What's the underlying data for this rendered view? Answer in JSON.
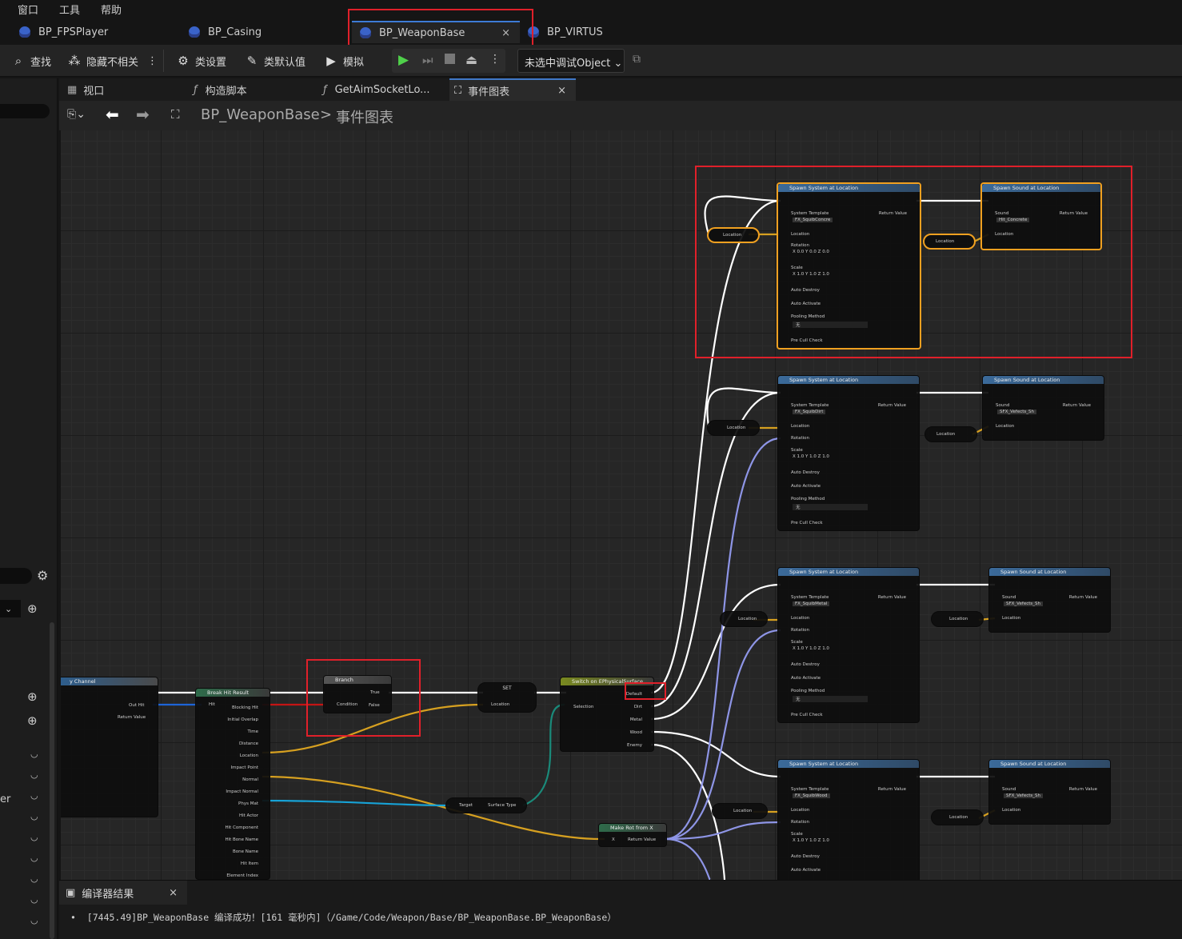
{
  "menu": [
    "窗口",
    "工具",
    "帮助"
  ],
  "file_tabs": [
    {
      "label": "BP_FPSPlayer"
    },
    {
      "label": "BP_Casing"
    },
    {
      "label": "BP_WeaponBase",
      "close": "×"
    },
    {
      "label": "BP_VIRTUS"
    }
  ],
  "toolbar": {
    "find": "查找",
    "hide_unrelated": "隐藏不相关",
    "class_settings": "类设置",
    "class_defaults": "类默认值",
    "simulate": "模拟",
    "debug_object": "未选中调试Object"
  },
  "sub_tabs": [
    {
      "label": "视口"
    },
    {
      "label": "构造脚本"
    },
    {
      "label": "GetAimSocketLo..."
    },
    {
      "label": "事件图表",
      "close": "×"
    }
  ],
  "breadcrumb": {
    "root": "BP_WeaponBase",
    "sep": ">",
    "leaf": "事件图表"
  },
  "left_panel": {
    "text": "er"
  },
  "nodes": {
    "trace": {
      "title": "y Channel",
      "pins": [
        "Out Hit",
        "Return Value"
      ]
    },
    "break_hit": {
      "title": "Break Hit Result",
      "in": "Hit",
      "pins": [
        "Blocking Hit",
        "Initial Overlap",
        "Time",
        "Distance",
        "Location",
        "Impact Point",
        "Normal",
        "Impact Normal",
        "Phys Mat",
        "Hit Actor",
        "Hit Component",
        "Hit Bone Name",
        "Bone Name",
        "Hit Item",
        "Element Index"
      ]
    },
    "branch": {
      "title": "Branch",
      "condition": "Condition",
      "true": "True",
      "false": "False"
    },
    "set": {
      "title": "SET",
      "location": "Location"
    },
    "switch": {
      "title": "Switch on EPhysicalSurface",
      "selection": "Selection",
      "outs": [
        "Default",
        "Dirt",
        "Metal",
        "Wood",
        "Enemy"
      ]
    },
    "surface": {
      "target": "Target",
      "out": "Surface Type"
    },
    "make_rot": {
      "title": "Make Rot from X",
      "x": "X",
      "ret": "Return Value"
    }
  },
  "spawn_system_title": "Spawn System at Location",
  "spawn_sound_title": "Spawn Sound at Location",
  "pin_labels": {
    "system_template": "System Template",
    "return_value": "Return Value",
    "location": "Location",
    "rotation": "Rotation",
    "scale": "Scale",
    "auto_destroy": "Auto Destroy",
    "auto_activate": "Auto Activate",
    "pooling_method": "Pooling Method",
    "pooling_value": "无",
    "pre_cull": "Pre Cull Check",
    "sound": "Sound",
    "zero": "0.0",
    "one": "1.0",
    "x": "X",
    "y": "Y",
    "z": "Z"
  },
  "system_assets": [
    "FX_SquibConcre",
    "FX_SquibDirt",
    "FX_SquibMetal",
    "FX_SquibWood"
  ],
  "sound_assets": [
    "Hit_Concrete",
    "SFX_Vefects_Sh",
    "SFX_Vefects_Sh",
    "SFX_Vefects_Sh"
  ],
  "colors": {
    "exec": "#ffffff",
    "vector": "#f1c232",
    "struct": "#1e64d8",
    "object": "#17a2d6",
    "rotator": "#8e95e6",
    "highlight": "#e0202a"
  },
  "compiler": {
    "tab": "编译器结果",
    "close": "×",
    "message": "[7445.49]BP_WeaponBase 编译成功！[161 毫秒内]（/Game/Code/Weapon/Base/BP_WeaponBase.BP_WeaponBase）"
  }
}
